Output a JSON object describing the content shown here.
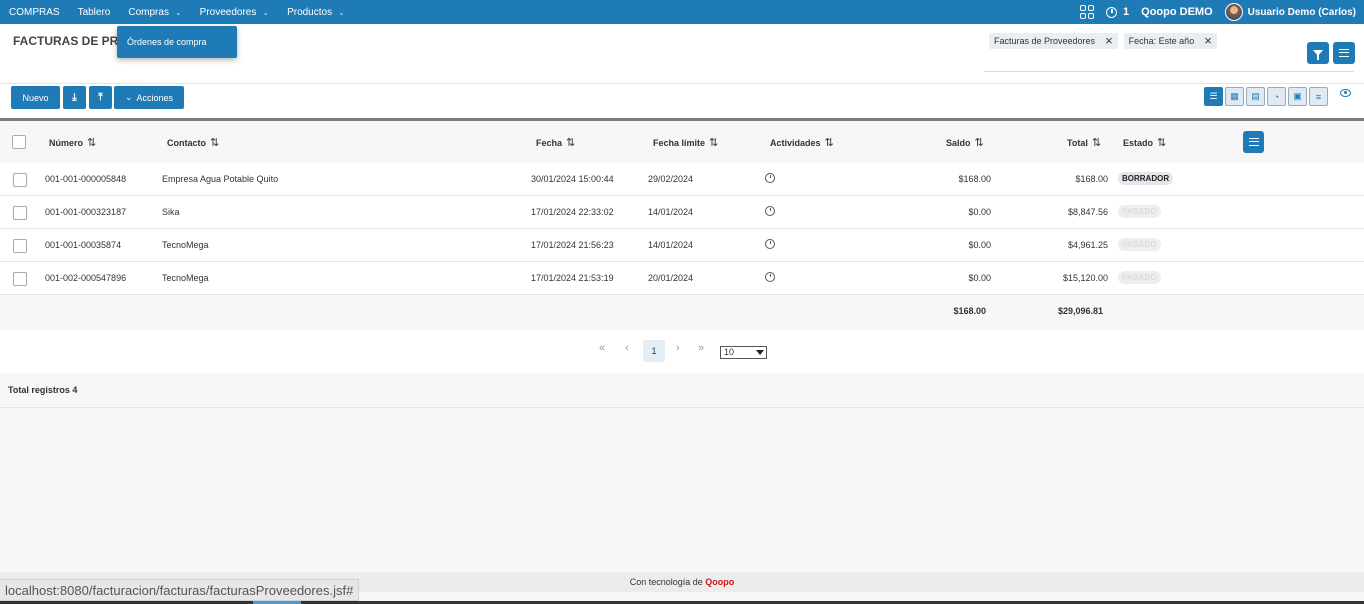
{
  "topbar": {
    "brand": "COMPRAS",
    "nav": [
      "Tablero",
      "Compras",
      "Proveedores",
      "Productos"
    ],
    "notification_count": "1",
    "company": "Qoopo DEMO",
    "user": "Usuario Demo (Carlos)"
  },
  "dropdown": {
    "item": "Órdenes de compra"
  },
  "header": {
    "title": "FACTURAS DE PR",
    "filters": [
      "Facturas de Proveedores",
      "Fecha: Este año"
    ]
  },
  "toolbar": {
    "new_label": "Nuevo",
    "actions_label": "Acciones"
  },
  "table": {
    "columns": [
      "Número",
      "Contacto",
      "Fecha",
      "Fecha límite",
      "Actividades",
      "Saldo",
      "Total",
      "Estado"
    ],
    "rows": [
      {
        "numero": "001-001-000005848",
        "contacto": "Empresa Agua Potable Quito",
        "fecha": "30/01/2024 15:00:44",
        "fecha_limite": "29/02/2024",
        "saldo": "$168.00",
        "total": "$168.00",
        "estado": "BORRADOR"
      },
      {
        "numero": "001-001-000323187",
        "contacto": "Sika",
        "fecha": "17/01/2024 22:33:02",
        "fecha_limite": "14/01/2024",
        "saldo": "$0.00",
        "total": "$8,847.56",
        "estado": "PAGADO"
      },
      {
        "numero": "001-001-00035874",
        "contacto": "TecnoMega",
        "fecha": "17/01/2024 21:56:23",
        "fecha_limite": "14/01/2024",
        "saldo": "$0.00",
        "total": "$4,961.25",
        "estado": "PAGADO"
      },
      {
        "numero": "001-002-000547896",
        "contacto": "TecnoMega",
        "fecha": "17/01/2024 21:53:19",
        "fecha_limite": "20/01/2024",
        "saldo": "$0.00",
        "total": "$15,120.00",
        "estado": "PAGADO"
      }
    ],
    "totals": {
      "saldo": "$168.00",
      "total": "$29,096.81"
    }
  },
  "pagination": {
    "current_page": "1",
    "page_size": "10"
  },
  "summary": {
    "total_records": "Total registros 4"
  },
  "footer": {
    "prefix": "Con tecnología de ",
    "brand": "Qoopo"
  },
  "status_url": "localhost:8080/facturacion/facturas/facturasProveedores.jsf#"
}
